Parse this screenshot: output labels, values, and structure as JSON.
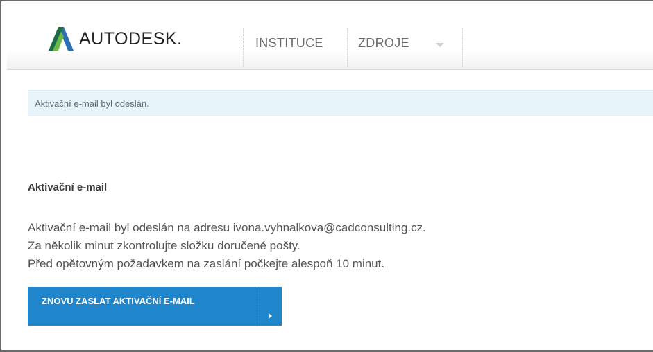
{
  "header": {
    "logo_text": "AUTODESK.",
    "nav": [
      {
        "label": "INSTITUCE"
      },
      {
        "label": "ZDROJE"
      }
    ]
  },
  "notice": {
    "text": "Aktivační e-mail byl odeslán."
  },
  "main": {
    "title": "Aktivační e-mail",
    "lines": [
      "Aktivační e-mail byl odeslán na adresu ivona.vyhnalkova@cadconsulting.cz.",
      "Za několik minut zkontrolujte složku doručené pošty.",
      "Před opětovným požadavkem na zaslání počkejte alespoň 10 minut."
    ],
    "resend_button_label": "ZNOVU ZASLAT AKTIVAČNÍ E-MAIL"
  },
  "colors": {
    "button": "#1f86cc",
    "notice_bg": "#e7f4f9",
    "text": "#555555"
  }
}
